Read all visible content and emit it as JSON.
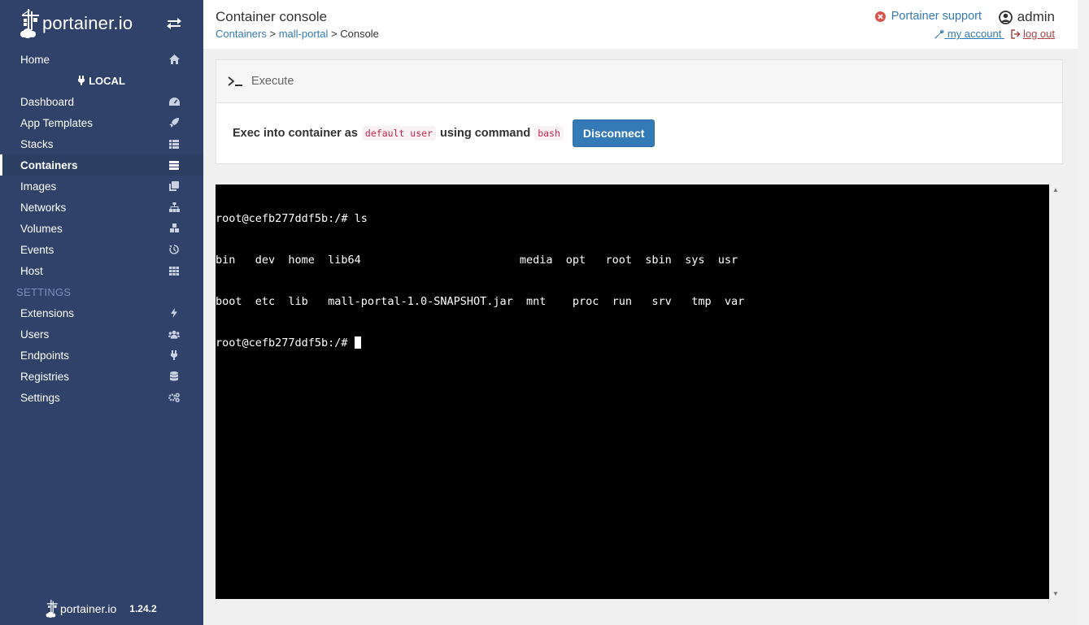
{
  "brand": {
    "name": "portainer.io"
  },
  "sidebar": {
    "home": "Home",
    "endpoint": "LOCAL",
    "items": [
      {
        "label": "Dashboard"
      },
      {
        "label": "App Templates"
      },
      {
        "label": "Stacks"
      },
      {
        "label": "Containers"
      },
      {
        "label": "Images"
      },
      {
        "label": "Networks"
      },
      {
        "label": "Volumes"
      },
      {
        "label": "Events"
      },
      {
        "label": "Host"
      }
    ],
    "settings_label": "SETTINGS",
    "settings_items": [
      {
        "label": "Extensions"
      },
      {
        "label": "Users"
      },
      {
        "label": "Endpoints"
      },
      {
        "label": "Registries"
      },
      {
        "label": "Settings"
      }
    ],
    "footer": {
      "name": "portainer.io",
      "version": "1.24.2"
    }
  },
  "header": {
    "title": "Container console",
    "breadcrumb": {
      "containers": "Containers",
      "sep1": " > ",
      "container": "mall-portal",
      "sep2": " > ",
      "current": "Console"
    },
    "support": "Portainer support",
    "user": "admin",
    "my_account": " my account ",
    "log_out": "log out"
  },
  "execute": {
    "title": "Execute",
    "text_before": "Exec into container as",
    "user": "default user",
    "text_middle": "using command",
    "command": "bash",
    "button": "Disconnect"
  },
  "terminal": {
    "lines": [
      "root@cefb277ddf5b:/# ls",
      "bin   dev  home  lib64                        media  opt   root  sbin  sys  usr",
      "boot  etc  lib   mall-portal-1.0-SNAPSHOT.jar  mnt    proc  run   srv   tmp  var"
    ],
    "prompt": "root@cefb277ddf5b:/# "
  },
  "colors": {
    "sidebar_bg": "#30426a",
    "accent": "#337ab7",
    "danger": "#a94442"
  }
}
